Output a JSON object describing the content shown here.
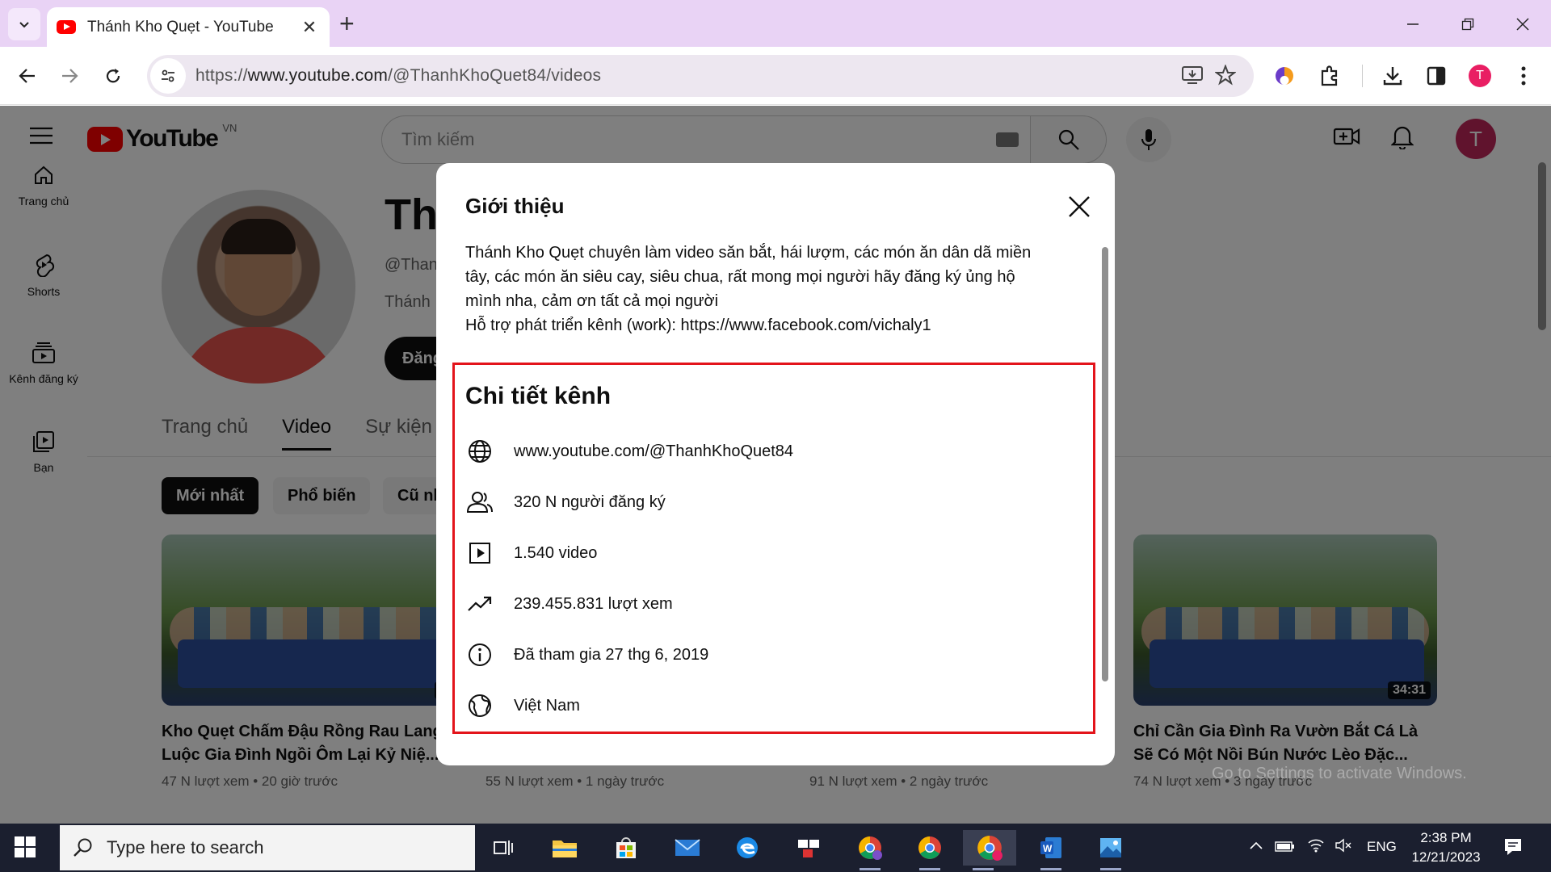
{
  "browser": {
    "tab_title": "Thánh Kho Quẹt - YouTube",
    "url_prefix": "https://",
    "url_host": "www.youtube.com",
    "url_path": "/@ThanhKhoQuet84/videos",
    "profile_initial": "T"
  },
  "youtube": {
    "country_code": "VN",
    "search_placeholder": "Tìm kiếm",
    "avatar_initial": "T",
    "sidebar": [
      {
        "label": "Trang chủ",
        "icon": "home-icon"
      },
      {
        "label": "Shorts",
        "icon": "shorts-icon"
      },
      {
        "label": "Kênh đăng ký",
        "icon": "subscriptions-icon"
      },
      {
        "label": "Bạn",
        "icon": "you-icon"
      }
    ],
    "channel": {
      "name_visible": "Th",
      "handle_visible": "@Than",
      "desc_visible": "Thánh",
      "subscribe_visible": "Đăng"
    },
    "tabs": [
      "Trang chủ",
      "Video",
      "Sự kiện"
    ],
    "chips": [
      "Mới nhất",
      "Phổ biến",
      "Cũ nh"
    ],
    "videos": [
      {
        "title": "Kho Quẹt Chấm Đậu Rồng Rau Lang Luộc Gia Đình Ngồi Ôm Lại Kỷ Niệ...",
        "meta": "47 N lượt xem • 20 giờ trước",
        "duration": "37"
      },
      {
        "title": "",
        "meta": "55 N lượt xem • 1 ngày trước",
        "duration": ""
      },
      {
        "title": "",
        "meta": "91 N lượt xem • 2 ngày trước",
        "duration": ""
      },
      {
        "title": "Chỉ Cần Gia Đình Ra Vườn Bắt Cá Là Sẽ Có Một Nồi Bún Nước Lèo Đặc...",
        "meta": "74 N lượt xem • 3 ngày trước",
        "duration": "34:31"
      }
    ],
    "activate_text": "Go to Settings to activate Windows."
  },
  "dialog": {
    "title": "Giới thiệu",
    "about_lines": [
      "Thánh Kho Quẹt chuyên làm video săn bắt,  hái lượm, các món ăn dân dã miền",
      "tây, các món ăn siêu cay, siêu chua,  rất mong mọi người hãy đăng ký ủng hộ",
      "mình nha,  cảm ơn tất cả mọi người",
      "Hỗ trợ phát triển kênh (work): https://www.facebook.com/vichaly1"
    ],
    "details_title": "Chi tiết kênh",
    "details": [
      {
        "icon": "globe-icon",
        "text": "www.youtube.com/@ThanhKhoQuet84"
      },
      {
        "icon": "subscribers-icon",
        "text": "320 N người đăng ký"
      },
      {
        "icon": "video-icon",
        "text": "1.540 video"
      },
      {
        "icon": "trending-icon",
        "text": "239.455.831 lượt xem"
      },
      {
        "icon": "info-icon",
        "text": "Đã tham gia 27 thg 6, 2019"
      },
      {
        "icon": "country-globe-icon",
        "text": "Việt Nam"
      }
    ],
    "highlight_color": "#e3141b"
  },
  "taskbar": {
    "search_placeholder": "Type here to search",
    "language": "ENG",
    "time": "2:38 PM",
    "date": "12/21/2023"
  }
}
